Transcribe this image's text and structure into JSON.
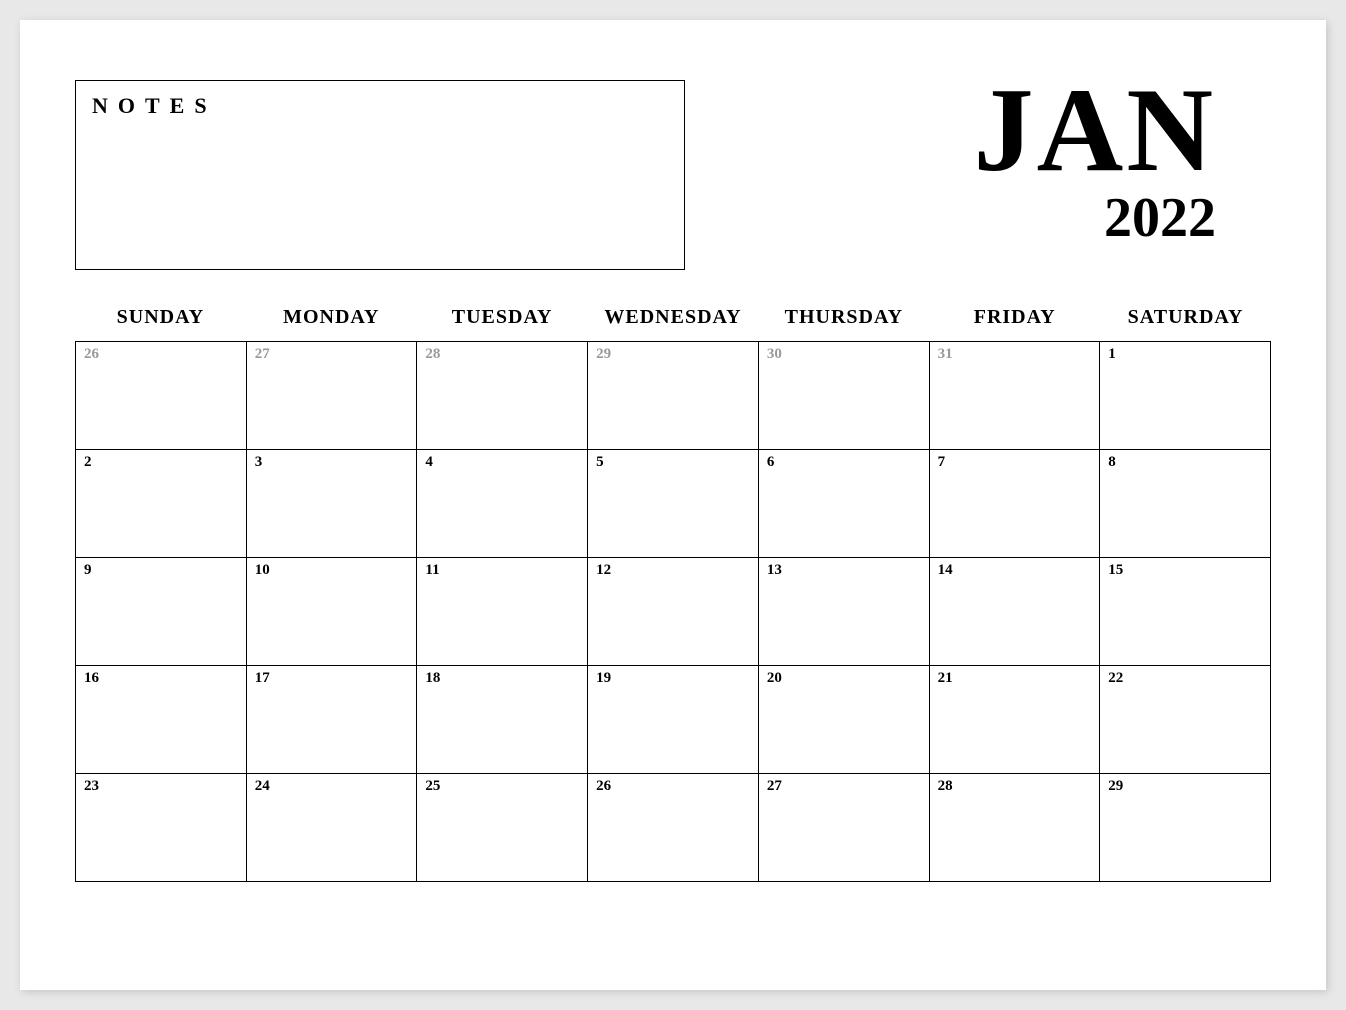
{
  "notes_label": "NOTES",
  "month": "JAN",
  "year": "2022",
  "dow": [
    "SUNDAY",
    "MONDAY",
    "TUESDAY",
    "WEDNESDAY",
    "THURSDAY",
    "FRIDAY",
    "SATURDAY"
  ],
  "weeks": [
    [
      {
        "n": "26",
        "muted": true
      },
      {
        "n": "27",
        "muted": true
      },
      {
        "n": "28",
        "muted": true
      },
      {
        "n": "29",
        "muted": true
      },
      {
        "n": "30",
        "muted": true
      },
      {
        "n": "31",
        "muted": true
      },
      {
        "n": "1",
        "muted": false
      }
    ],
    [
      {
        "n": "2",
        "muted": false
      },
      {
        "n": "3",
        "muted": false
      },
      {
        "n": "4",
        "muted": false
      },
      {
        "n": "5",
        "muted": false
      },
      {
        "n": "6",
        "muted": false
      },
      {
        "n": "7",
        "muted": false
      },
      {
        "n": "8",
        "muted": false
      }
    ],
    [
      {
        "n": "9",
        "muted": false
      },
      {
        "n": "10",
        "muted": false
      },
      {
        "n": "11",
        "muted": false
      },
      {
        "n": "12",
        "muted": false
      },
      {
        "n": "13",
        "muted": false
      },
      {
        "n": "14",
        "muted": false
      },
      {
        "n": "15",
        "muted": false
      }
    ],
    [
      {
        "n": "16",
        "muted": false
      },
      {
        "n": "17",
        "muted": false
      },
      {
        "n": "18",
        "muted": false
      },
      {
        "n": "19",
        "muted": false
      },
      {
        "n": "20",
        "muted": false
      },
      {
        "n": "21",
        "muted": false
      },
      {
        "n": "22",
        "muted": false
      }
    ],
    [
      {
        "n": "23",
        "muted": false
      },
      {
        "n": "24",
        "muted": false
      },
      {
        "n": "25",
        "muted": false
      },
      {
        "n": "26",
        "muted": false
      },
      {
        "n": "27",
        "muted": false
      },
      {
        "n": "28",
        "muted": false
      },
      {
        "n": "29",
        "muted": false
      }
    ]
  ]
}
